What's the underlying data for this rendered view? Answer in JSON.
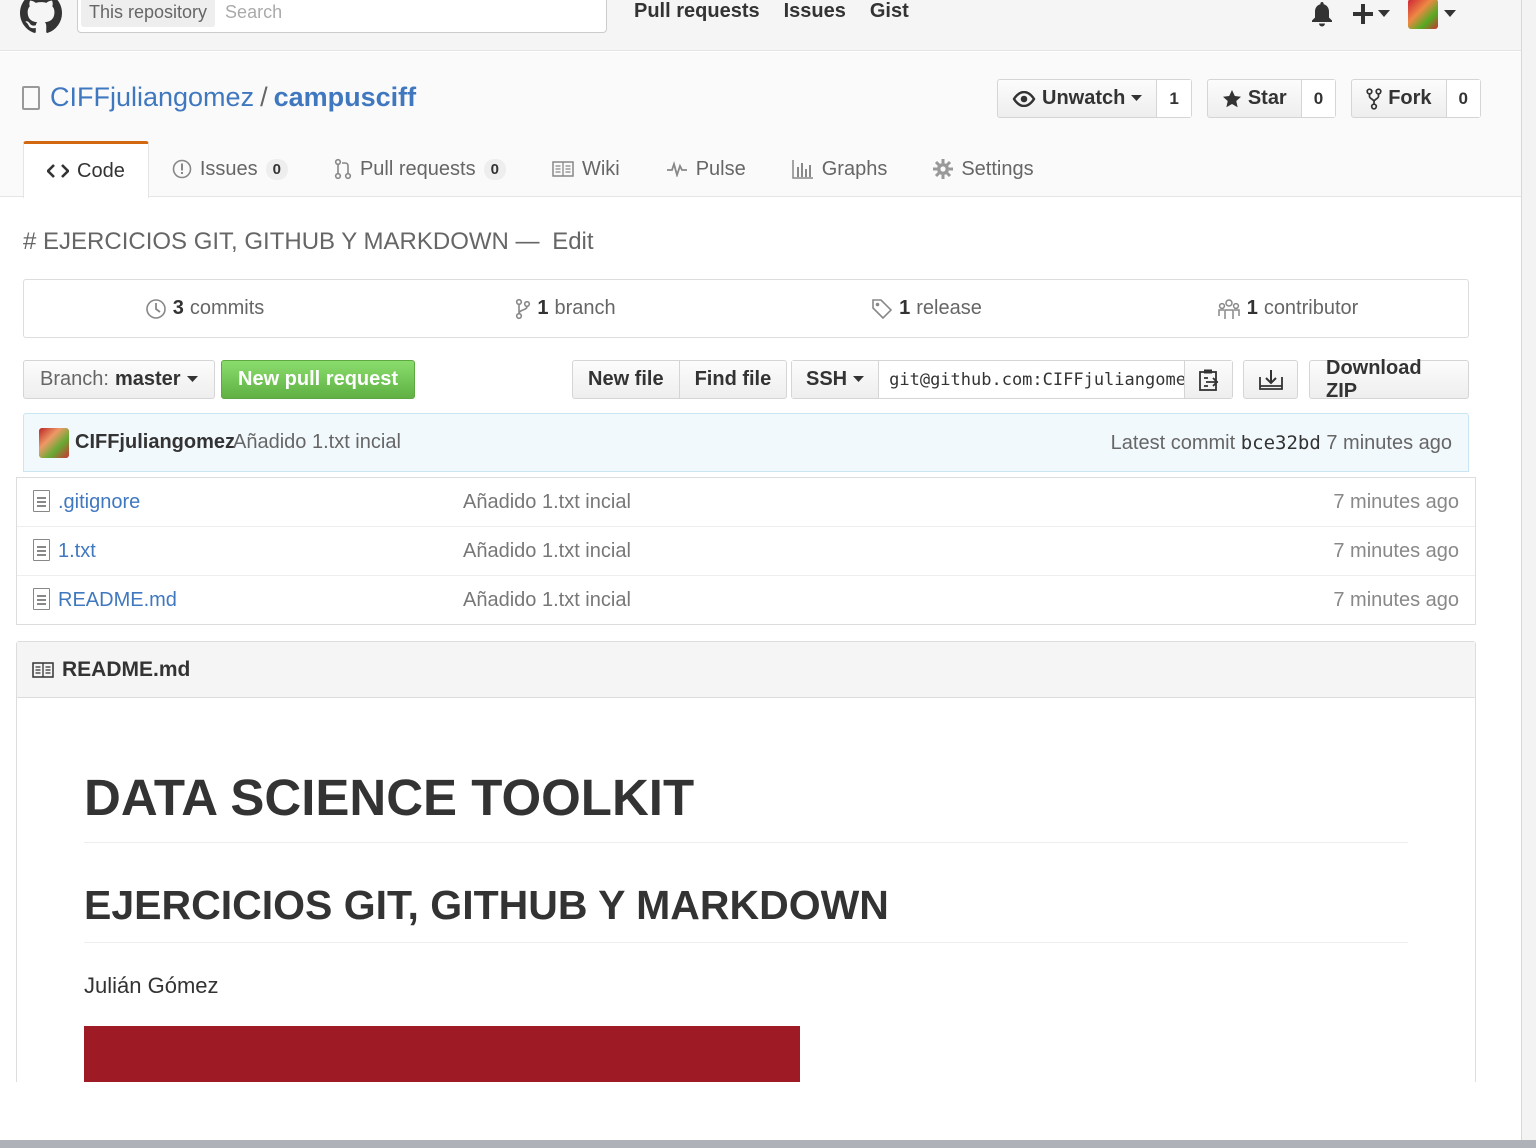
{
  "header": {
    "search_scope": "This repository",
    "search_placeholder": "Search",
    "nav": [
      "Pull requests",
      "Issues",
      "Gist"
    ],
    "icons": [
      "github-logo",
      "bell-icon",
      "plus-icon",
      "avatar"
    ]
  },
  "repo": {
    "owner": "CIFFjuliangomez",
    "separator": "/",
    "name": "campusciff",
    "watch_label": "Unwatch",
    "watch_count": "1",
    "star_label": "Star",
    "star_count": "0",
    "fork_label": "Fork",
    "fork_count": "0"
  },
  "tabs": [
    {
      "label": "Code",
      "icon": "code-icon",
      "selected": true
    },
    {
      "label": "Issues",
      "icon": "issue-icon",
      "counter": "0"
    },
    {
      "label": "Pull requests",
      "icon": "pr-icon",
      "counter": "0"
    },
    {
      "label": "Wiki",
      "icon": "book-icon"
    },
    {
      "label": "Pulse",
      "icon": "pulse-icon"
    },
    {
      "label": "Graphs",
      "icon": "graph-icon"
    },
    {
      "label": "Settings",
      "icon": "gear-icon"
    }
  ],
  "description": {
    "text": "# EJERCICIOS GIT, GITHUB Y MARKDOWN",
    "dash": "—",
    "edit": "Edit"
  },
  "summary": [
    {
      "count": "3",
      "label": "commits"
    },
    {
      "count": "1",
      "label": "branch"
    },
    {
      "count": "1",
      "label": "release"
    },
    {
      "count": "1",
      "label": "contributor"
    }
  ],
  "filebar": {
    "branch_prefix": "Branch:",
    "branch": "master",
    "new_pr": "New pull request",
    "new_file": "New file",
    "find_file": "Find file",
    "protocol": "SSH",
    "clone_url": "git@github.com:CIFFjuliangomez/campusciff.git",
    "download_zip": "Download ZIP"
  },
  "latest_commit": {
    "author": "CIFFjuliangomez",
    "message": "Añadido 1.txt incial",
    "prefix": "Latest commit",
    "sha": "bce32bd",
    "age": "7 minutes ago"
  },
  "files": [
    {
      "name": ".gitignore",
      "message": "Añadido 1.txt incial",
      "age": "7 minutes ago"
    },
    {
      "name": "1.txt",
      "message": "Añadido 1.txt incial",
      "age": "7 minutes ago"
    },
    {
      "name": "README.md",
      "message": "Añadido 1.txt incial",
      "age": "7 minutes ago"
    }
  ],
  "readme": {
    "title": "README.md",
    "h1": "DATA SCIENCE TOOLKIT",
    "h2": "EJERCICIOS GIT, GITHUB Y MARKDOWN",
    "author": "Julián Gómez",
    "banner_color": "#9e1b26"
  },
  "colors": {
    "link": "#4078c0",
    "accent_tab": "#d26911",
    "green_button": "#60b044"
  }
}
